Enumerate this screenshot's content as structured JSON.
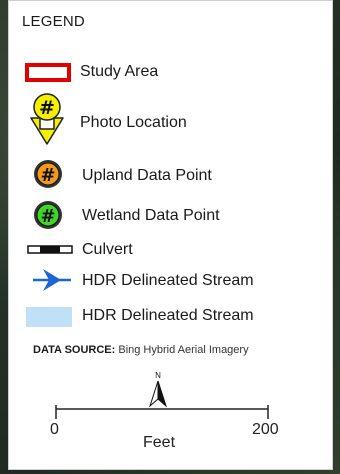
{
  "legend": {
    "title": "LEGEND",
    "items": [
      {
        "label": "Study Area",
        "symbol": "red-rectangle-outline",
        "color": "#e00000"
      },
      {
        "label": "Photo Location",
        "symbol": "yellow-arrow-marker",
        "badge": "#",
        "color": "#f5f000"
      },
      {
        "label": "Upland Data Point",
        "symbol": "orange-circle-marker",
        "badge": "#",
        "color": "#f29a1e"
      },
      {
        "label": "Wetland Data Point",
        "symbol": "green-circle-marker",
        "badge": "#",
        "color": "#3fd62a"
      },
      {
        "label": "Culvert",
        "symbol": "culvert-line"
      },
      {
        "label": "HDR Delineated Stream",
        "symbol": "blue-arrow-line",
        "color": "#1e66d6"
      },
      {
        "label": "HDR Delineated Stream",
        "symbol": "light-blue-fill",
        "color": "#bfe0f6"
      }
    ],
    "data_source": {
      "label": "DATA SOURCE:",
      "value": "Bing Hybrid Aerial Imagery"
    },
    "north_arrow": {
      "label": "N"
    },
    "scale_bar": {
      "start": "0",
      "end": "200",
      "unit": "Feet"
    }
  }
}
